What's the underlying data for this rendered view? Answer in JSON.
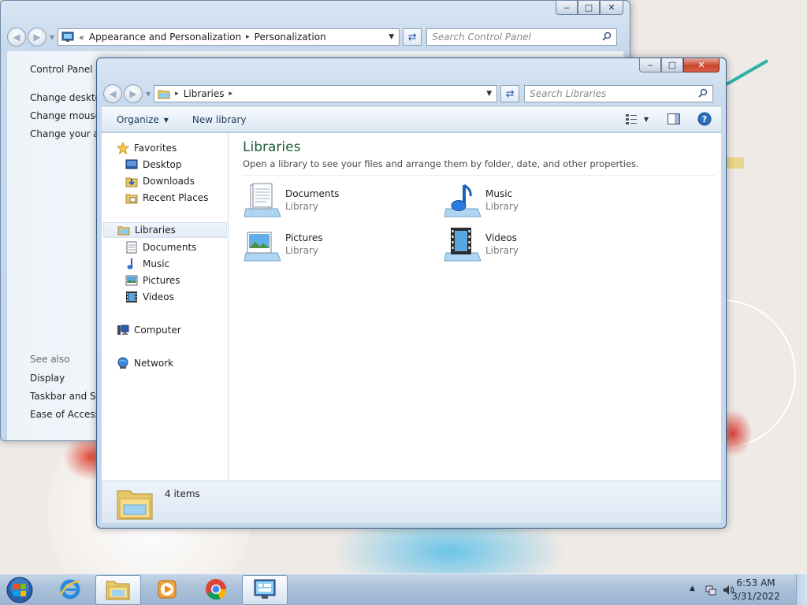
{
  "control_panel": {
    "breadcrumb": [
      "Appearance and Personalization",
      "Personalization"
    ],
    "search_placeholder": "Search Control Panel",
    "left_links": [
      "Control Panel H",
      "Change desktop",
      "Change mouse p",
      "Change your ac"
    ],
    "see_also_label": "See also",
    "see_also_links": [
      "Display",
      "Taskbar and Star",
      "Ease of Access C"
    ]
  },
  "libraries": {
    "address_crumb": "Libraries",
    "search_placeholder": "Search Libraries",
    "toolbar": {
      "organize": "Organize",
      "new_library": "New library"
    },
    "nav": {
      "favorites": "Favorites",
      "favorite_items": [
        "Desktop",
        "Downloads",
        "Recent Places"
      ],
      "libraries": "Libraries",
      "library_items": [
        "Documents",
        "Music",
        "Pictures",
        "Videos"
      ],
      "computer": "Computer",
      "network": "Network"
    },
    "heading": "Libraries",
    "subheading": "Open a library to see your files and arrange them by folder, date, and other properties.",
    "tiles": [
      {
        "name": "Documents",
        "type": "Library",
        "icon": "documents-library-icon"
      },
      {
        "name": "Music",
        "type": "Library",
        "icon": "music-library-icon"
      },
      {
        "name": "Pictures",
        "type": "Library",
        "icon": "pictures-library-icon"
      },
      {
        "name": "Videos",
        "type": "Library",
        "icon": "videos-library-icon"
      }
    ],
    "status": "4 items"
  },
  "taskbar": {
    "items": [
      "start-orb",
      "internet-explorer",
      "windows-explorer",
      "windows-media-player",
      "google-chrome",
      "control-panel"
    ],
    "clock_time": "6:53 AM",
    "clock_date": "3/31/2022"
  },
  "colors": {
    "heading_green": "#1e5a3a",
    "close_red": "#c8462c",
    "taskbar": "#a9c0d9"
  }
}
